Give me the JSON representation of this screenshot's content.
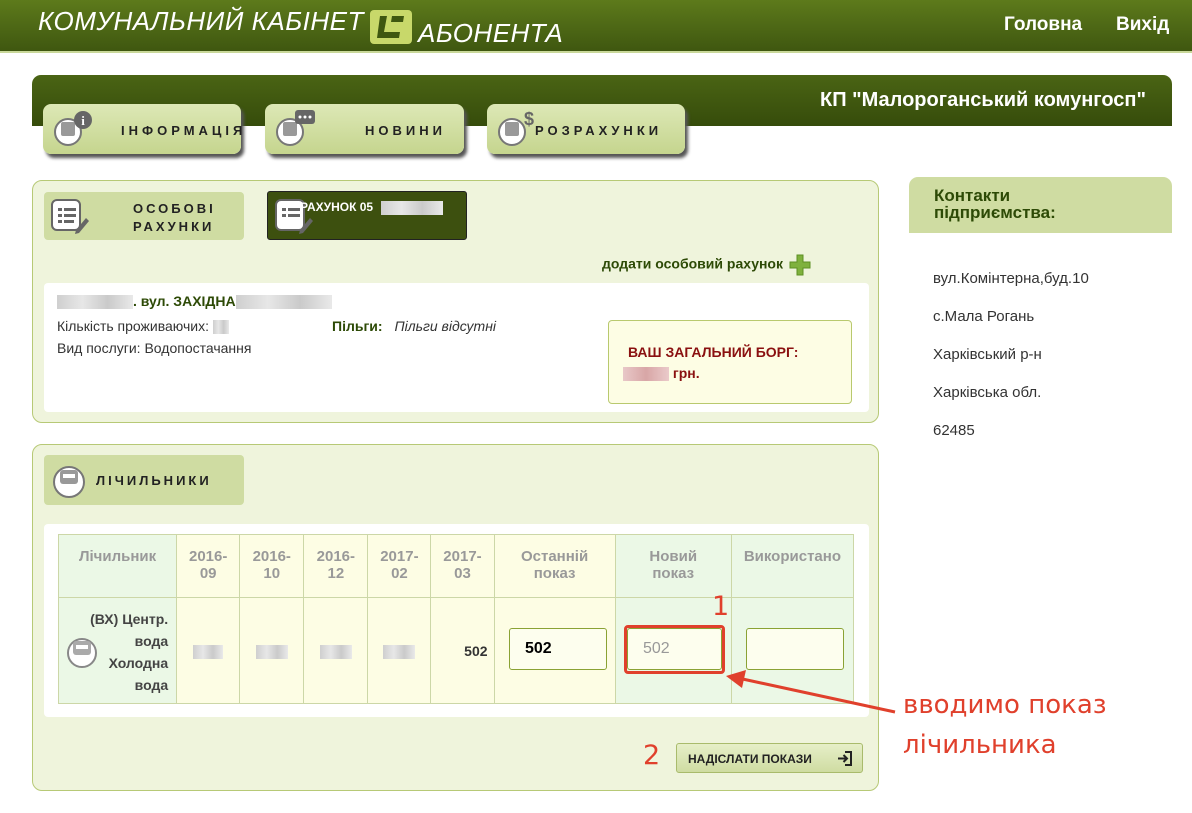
{
  "header": {
    "logo_part1": "КОМУНАЛЬНИЙ КАБІНЕТ",
    "logo_part2": "АБОНЕНТА",
    "nav_home": "Головна",
    "nav_exit": "Вихід"
  },
  "banner": {
    "company": "КП \"Малороганський комунгосп\""
  },
  "tabs": [
    {
      "label": "ІНФОРМАЦІЯ",
      "icon": "info-icon"
    },
    {
      "label": "НОВИНИ",
      "icon": "news-icon"
    },
    {
      "label": "РОЗРАХУНКИ",
      "icon": "payments-icon"
    }
  ],
  "accounts": {
    "title_line1": "ОСОБОВІ",
    "title_line2": "РАХУНКИ",
    "account_tab": "РАХУНОК 05",
    "add_account": "додати особовий рахунок",
    "address": ". вул. ЗАХІДНА",
    "residents_label": "Кількість проживаючих:",
    "benefits_label": "Пільги:",
    "benefits_value": "Пільги відсутні",
    "service_label": "Вид послуги:",
    "service_value": "Водопостачання",
    "debt_label": "ВАШ ЗАГАЛЬНИЙ БОРГ:",
    "debt_currency": "грн."
  },
  "meters": {
    "title": "ЛІЧИЛЬНИКИ",
    "columns": [
      "Лічильник",
      "2016-09",
      "2016-10",
      "2016-12",
      "2017-02",
      "2017-03",
      "Останній показ",
      "Новий показ",
      "Використано"
    ],
    "row": {
      "name_line1": "(ВХ) Центр.",
      "name_line2": "вода",
      "name_line3": "Холодна",
      "name_line4": "вода",
      "reading_2017_03": "502",
      "last_reading": "502",
      "new_reading_placeholder": "502",
      "used": ""
    },
    "submit": "НАДІСЛАТИ ПОКАЗИ"
  },
  "contacts": {
    "title": "Контакти підприємства:",
    "street": "вул.Комінтерна,буд.10",
    "village": "с.Мала Рогань",
    "district": "Харківський р-н",
    "region": "Харківська обл.",
    "postcode": "62485"
  },
  "annotations": {
    "step1": "1",
    "step2": "2",
    "hint_line1": "вводимо показ",
    "hint_line2": "лічильника"
  }
}
